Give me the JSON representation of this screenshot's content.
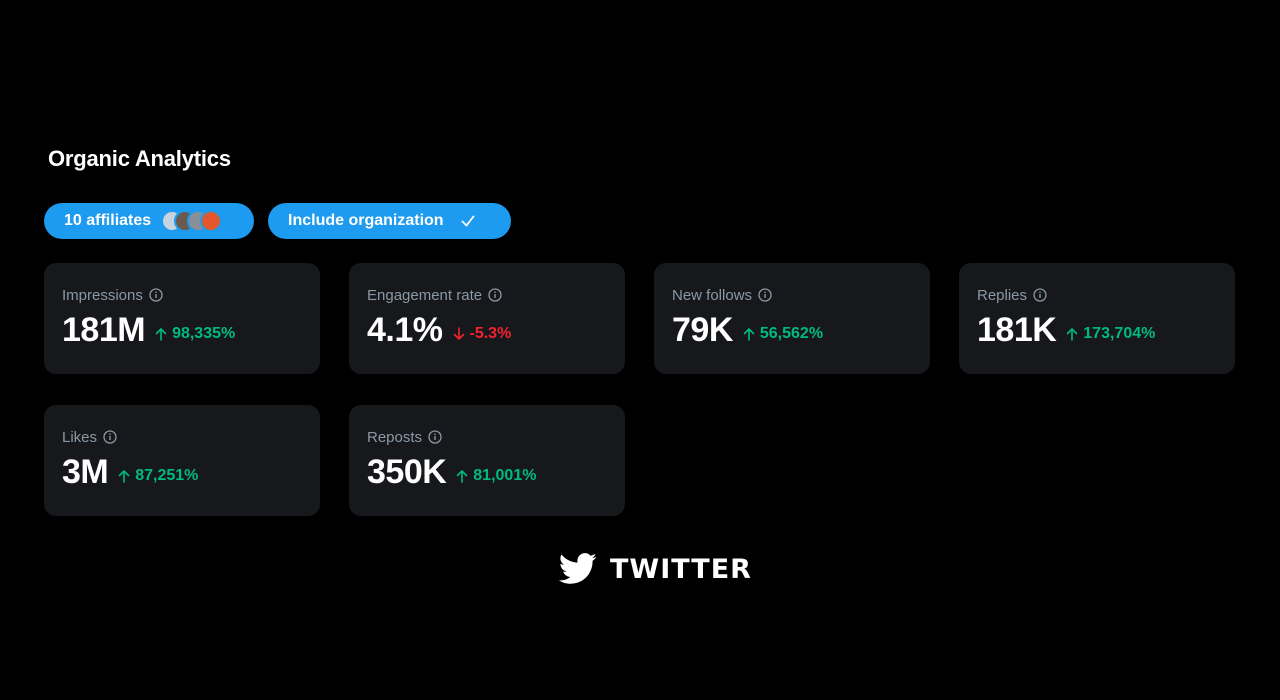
{
  "header": {
    "title": "Organic Analytics"
  },
  "filters": {
    "affiliates_label": "10 affiliates",
    "affiliate_avatars": [
      "#c8d3e0",
      "#6b5a4e",
      "#8a8f96",
      "#e2572b"
    ],
    "include_label": "Include organization"
  },
  "metrics": [
    {
      "label": "Impressions",
      "value": "181M",
      "change": "98,335%",
      "direction": "up"
    },
    {
      "label": "Engagement rate",
      "value": "4.1%",
      "change": "-5.3%",
      "direction": "down"
    },
    {
      "label": "New follows",
      "value": "79K",
      "change": "56,562%",
      "direction": "up"
    },
    {
      "label": "Replies",
      "value": "181K",
      "change": "173,704%",
      "direction": "up"
    },
    {
      "label": "Likes",
      "value": "3M",
      "change": "87,251%",
      "direction": "up"
    },
    {
      "label": "Reposts",
      "value": "350K",
      "change": "81,001%",
      "direction": "up"
    }
  ],
  "brand": {
    "name": "TWITTER",
    "icon": "twitter-bird-icon"
  },
  "colors": {
    "accent": "#1d9bf0",
    "positive": "#00ba7c",
    "negative": "#f4212e",
    "card_bg": "#16181c",
    "page_bg": "#000000"
  }
}
